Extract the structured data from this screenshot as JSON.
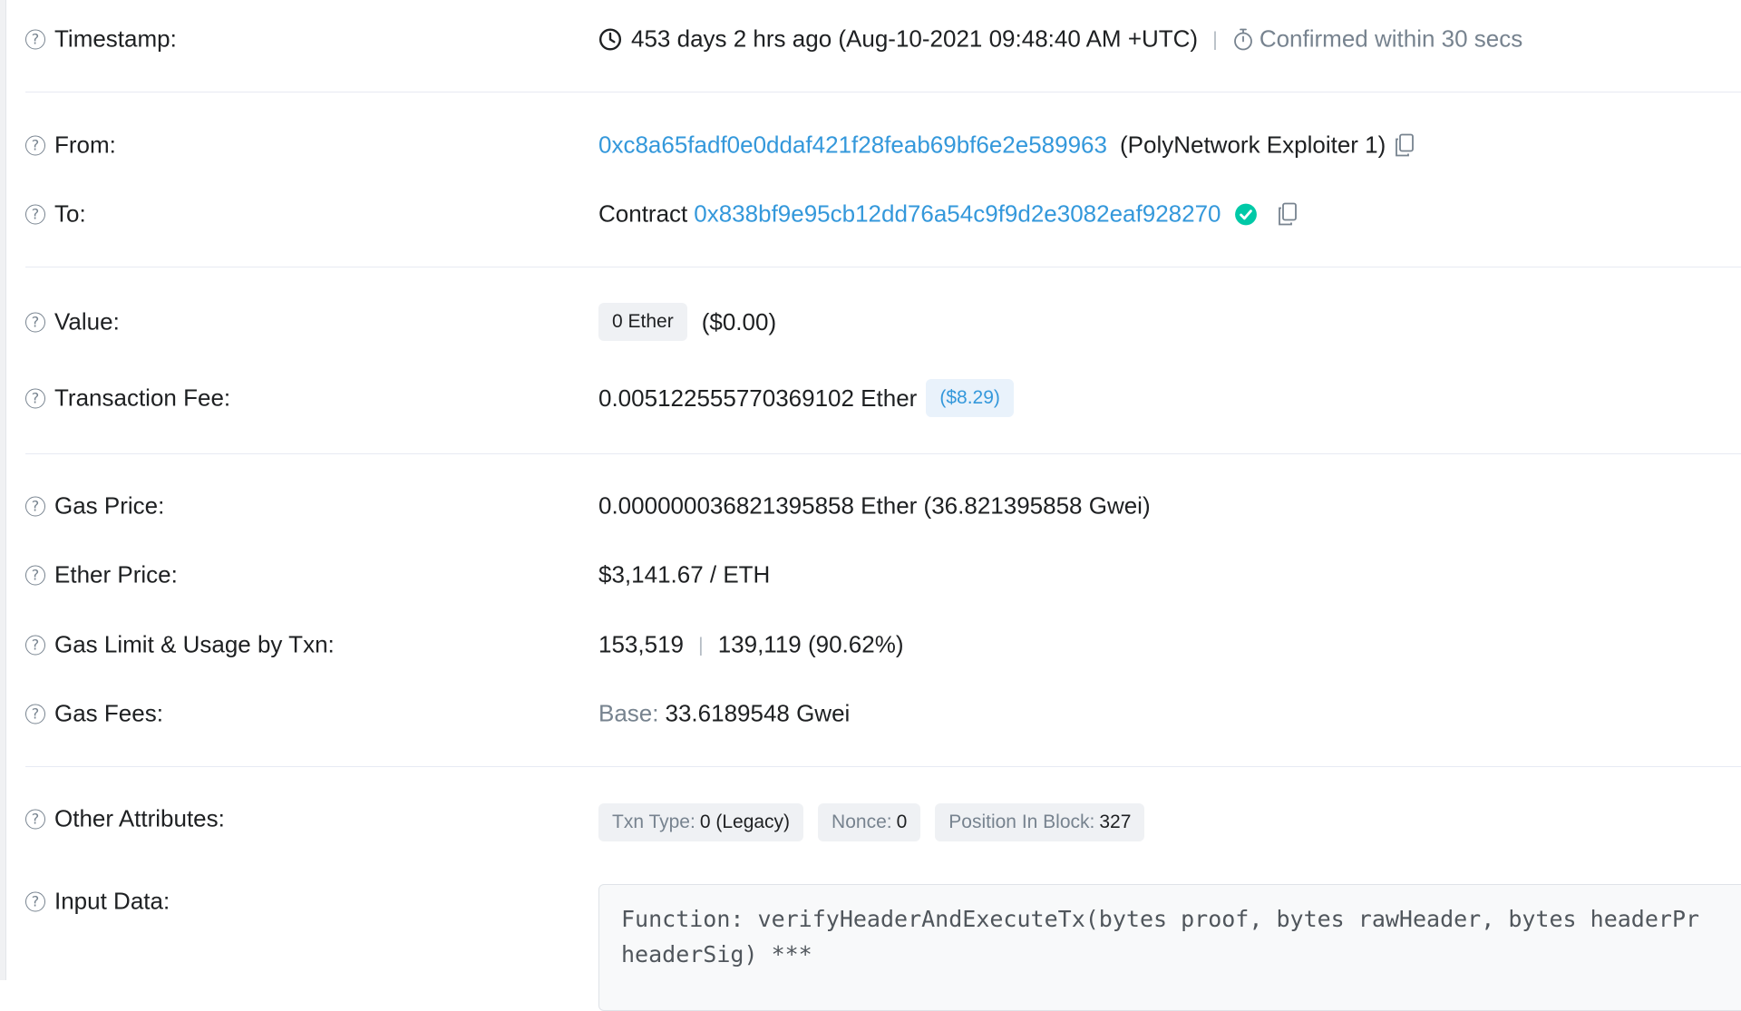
{
  "timestamp": {
    "label": "Timestamp:",
    "relative": "453 days 2 hrs ago (Aug-10-2021 09:48:40 AM +UTC)",
    "confirmed": "Confirmed within 30 secs"
  },
  "from": {
    "label": "From:",
    "address": "0xc8a65fadf0e0ddaf421f28feab69bf6e2e589963",
    "name": "(PolyNetwork Exploiter 1)"
  },
  "to": {
    "label": "To:",
    "prefix": "Contract",
    "address": "0x838bf9e95cb12dd76a54c9f9d2e3082eaf928270"
  },
  "value": {
    "label": "Value:",
    "amount": "0 Ether",
    "usd": "($0.00)"
  },
  "fee": {
    "label": "Transaction Fee:",
    "amount": "0.005122555770369102 Ether",
    "usd": "($8.29)"
  },
  "gas_price": {
    "label": "Gas Price:",
    "value": "0.000000036821395858 Ether (36.821395858 Gwei)"
  },
  "ether_price": {
    "label": "Ether Price:",
    "value": "$3,141.67 / ETH"
  },
  "gas_limit": {
    "label": "Gas Limit & Usage by Txn:",
    "limit": "153,519",
    "separator": "|",
    "usage": "139,119 (90.62%)"
  },
  "gas_fees": {
    "label": "Gas Fees:",
    "base_label": "Base:",
    "base_value": "33.6189548 Gwei"
  },
  "other": {
    "label": "Other Attributes:",
    "txn_type_label": "Txn Type:",
    "txn_type_value": "0 (Legacy)",
    "nonce_label": "Nonce:",
    "nonce_value": "0",
    "position_label": "Position In Block:",
    "position_value": "327"
  },
  "input_data": {
    "label": "Input Data:",
    "code": "Function: verifyHeaderAndExecuteTx(bytes proof, bytes rawHeader, bytes headerPr\nheaderSig) ***"
  },
  "help_glyph": "?",
  "colors": {
    "link": "#3498db",
    "muted": "#77838f",
    "verified": "#00c9a7",
    "text": "#1e2022"
  }
}
